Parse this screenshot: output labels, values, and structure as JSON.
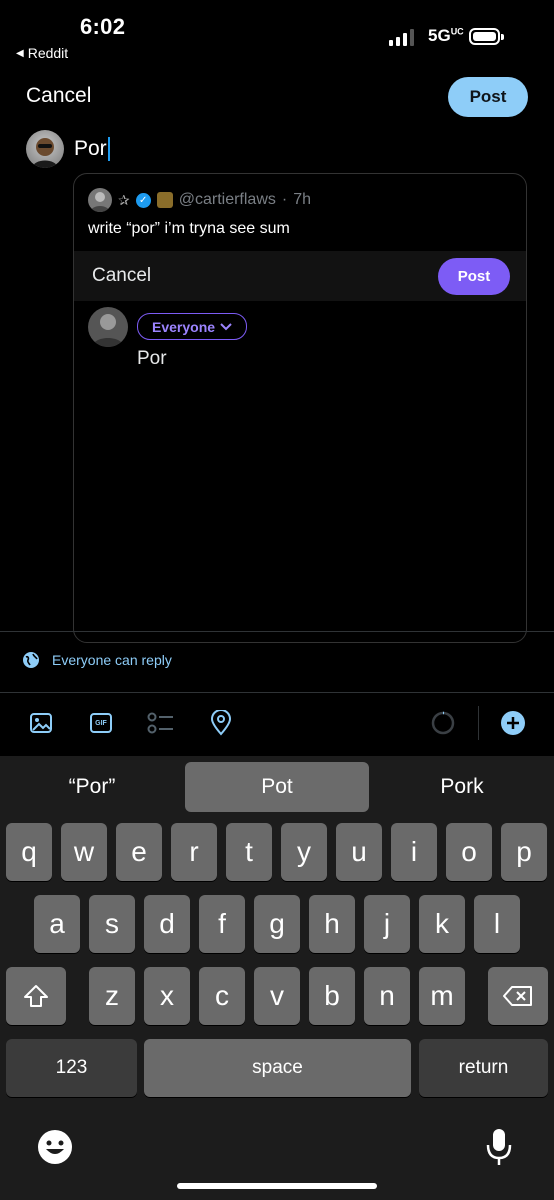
{
  "status_bar": {
    "time": "6:02",
    "back_app": "Reddit",
    "network": "5G",
    "network_sup": "UC"
  },
  "compose": {
    "cancel_label": "Cancel",
    "post_label": "Post",
    "text": "Por"
  },
  "quoted": {
    "handle": "@cartierflaws",
    "dot": "·",
    "time": "7h",
    "text": "write  “por” i’m tryna see sum",
    "inner": {
      "cancel_label": "Cancel",
      "post_label": "Post",
      "audience_label": "Everyone",
      "text": "Por"
    }
  },
  "reply_setting": {
    "label": "Everyone can reply"
  },
  "toolbar": {
    "icons": [
      "image-icon",
      "gif-icon",
      "poll-icon",
      "location-icon",
      "character-counter-icon",
      "add-thread-icon"
    ],
    "gif_label": "GIF"
  },
  "keyboard": {
    "suggestions": [
      "“Por”",
      "Pot",
      "Pork"
    ],
    "row1": [
      "q",
      "w",
      "e",
      "r",
      "t",
      "y",
      "u",
      "i",
      "o",
      "p"
    ],
    "row2": [
      "a",
      "s",
      "d",
      "f",
      "g",
      "h",
      "j",
      "k",
      "l"
    ],
    "row3": [
      "z",
      "x",
      "c",
      "v",
      "b",
      "n",
      "m"
    ],
    "numbers_label": "123",
    "space_label": "space",
    "return_label": "return"
  },
  "colors": {
    "accent_blue": "#8ecdf8",
    "accent_purple": "#7d5cf5",
    "verified_blue": "#1d9bf0"
  }
}
